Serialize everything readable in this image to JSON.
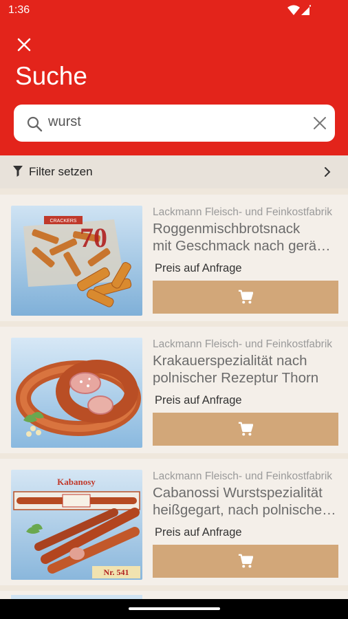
{
  "status": {
    "time": "1:36"
  },
  "header": {
    "title": "Suche"
  },
  "search": {
    "value": "wurst"
  },
  "filter": {
    "label": "Filter setzen"
  },
  "products": [
    {
      "vendor": "Lackmann Fleisch- und Feinkostfabrik",
      "name_line1": "Roggenmischbrotsnack",
      "name_line2": "mit Geschmack nach geräuchertem Speck",
      "price": "Preis auf Anfrage"
    },
    {
      "vendor": "Lackmann Fleisch- und Feinkostfabrik",
      "name_line1": "Krakauerspezialität nach",
      "name_line2": "polnischer Rezeptur Thorn",
      "price": "Preis auf Anfrage"
    },
    {
      "vendor": "Lackmann Fleisch- und Feinkostfabrik",
      "name_line1": "Cabanossi Wurstspezialität",
      "name_line2": "heißgegart, nach polnischer Rezeptur",
      "price": "Preis auf Anfrage"
    }
  ],
  "image_text": {
    "kabanosy": "Kabanosy",
    "nr": "Nr. 541",
    "crackers": "CRACKERS"
  },
  "colors": {
    "primary": "#e3241b",
    "cart_button": "#d2a779",
    "background": "#efe7dc"
  }
}
